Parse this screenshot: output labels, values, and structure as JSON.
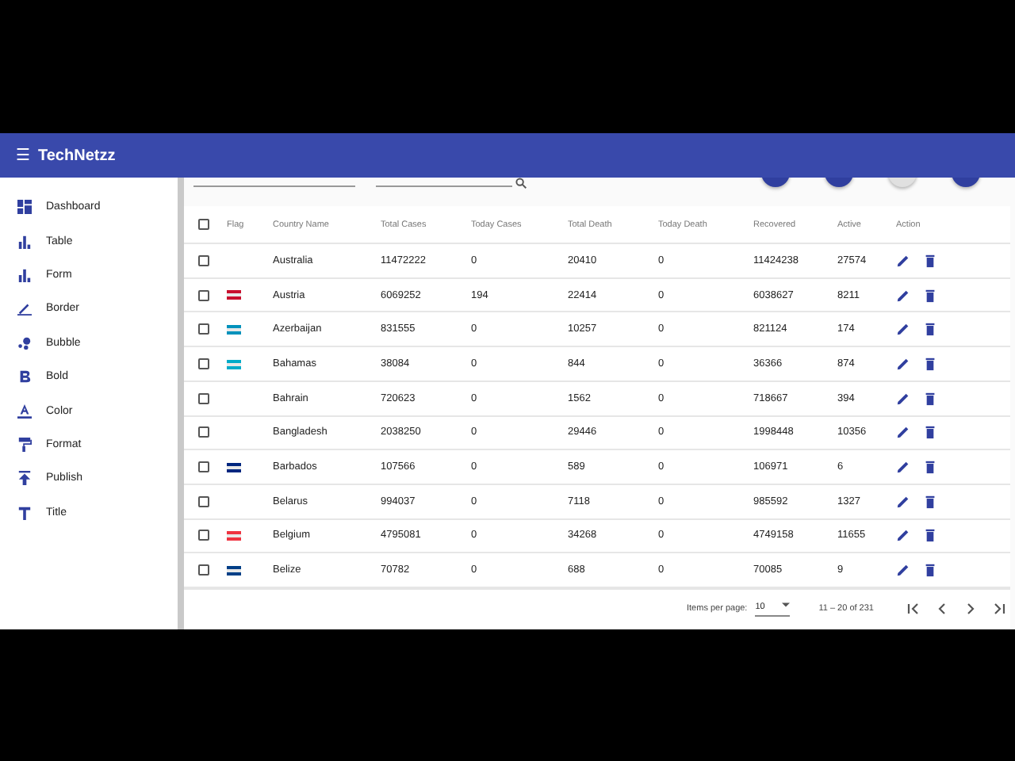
{
  "app_bar": {
    "menu_icon": "☰",
    "title": "TechNetzz"
  },
  "sidebar": {
    "items": [
      {
        "label": "Dashboard",
        "kind": "dashboard"
      },
      {
        "label": "Table",
        "kind": "bars"
      },
      {
        "label": "Form",
        "kind": "bars"
      },
      {
        "label": "Border",
        "kind": "pen"
      },
      {
        "label": "Bubble",
        "kind": "bubble"
      },
      {
        "label": "Bold",
        "kind": "bold"
      },
      {
        "label": "Color",
        "kind": "color"
      },
      {
        "label": "Format",
        "kind": "roller"
      },
      {
        "label": "Publish",
        "kind": "publish"
      },
      {
        "label": "Title",
        "kind": "title"
      }
    ]
  },
  "toolbar": {
    "fab_buttons": [
      {
        "disabled": false
      },
      {
        "disabled": false
      },
      {
        "disabled": true
      },
      {
        "disabled": false
      }
    ]
  },
  "table": {
    "header_checked": false,
    "columns": [
      "Flag",
      "Country Name",
      "Total Cases",
      "Today Cases",
      "Total Death",
      "Today Death",
      "Recovered",
      "Active",
      "Action"
    ],
    "rows": [
      {
        "checked": false,
        "country": "Australia",
        "total_cases": "11472222",
        "today_cases": "0",
        "total_death": "20410",
        "today_death": "0",
        "recovered": "11424238",
        "active": "27574"
      },
      {
        "checked": false,
        "flag": {
          "color": "#c8102e"
        },
        "country": "Austria",
        "total_cases": "6069252",
        "today_cases": "194",
        "total_death": "22414",
        "today_death": "0",
        "recovered": "6038627",
        "active": "8211"
      },
      {
        "checked": false,
        "flag": {
          "color": "#0092bc"
        },
        "country": "Azerbaijan",
        "total_cases": "831555",
        "today_cases": "0",
        "total_death": "10257",
        "today_death": "0",
        "recovered": "821124",
        "active": "174"
      },
      {
        "checked": false,
        "flag": {
          "color": "#00abc9"
        },
        "country": "Bahamas",
        "total_cases": "38084",
        "today_cases": "0",
        "total_death": "844",
        "today_death": "0",
        "recovered": "36366",
        "active": "874"
      },
      {
        "checked": false,
        "country": "Bahrain",
        "total_cases": "720623",
        "today_cases": "0",
        "total_death": "1562",
        "today_death": "0",
        "recovered": "718667",
        "active": "394"
      },
      {
        "checked": false,
        "country": "Bangladesh",
        "total_cases": "2038250",
        "today_cases": "0",
        "total_death": "29446",
        "today_death": "0",
        "recovered": "1998448",
        "active": "10356"
      },
      {
        "checked": false,
        "flag": {
          "color": "#00267f"
        },
        "country": "Barbados",
        "total_cases": "107566",
        "today_cases": "0",
        "total_death": "589",
        "today_death": "0",
        "recovered": "106971",
        "active": "6"
      },
      {
        "checked": false,
        "country": "Belarus",
        "total_cases": "994037",
        "today_cases": "0",
        "total_death": "7118",
        "today_death": "0",
        "recovered": "985592",
        "active": "1327"
      },
      {
        "checked": false,
        "flag": {
          "color": "#ef3340"
        },
        "country": "Belgium",
        "total_cases": "4795081",
        "today_cases": "0",
        "total_death": "34268",
        "today_death": "0",
        "recovered": "4749158",
        "active": "11655"
      },
      {
        "checked": false,
        "flag": {
          "color": "#003f87"
        },
        "country": "Belize",
        "total_cases": "70782",
        "today_cases": "0",
        "total_death": "688",
        "today_death": "0",
        "recovered": "70085",
        "active": "9"
      }
    ]
  },
  "paginator": {
    "items_per_page_label": "Items per page:",
    "page_size": "10",
    "range": "11 – 20 of 231"
  }
}
